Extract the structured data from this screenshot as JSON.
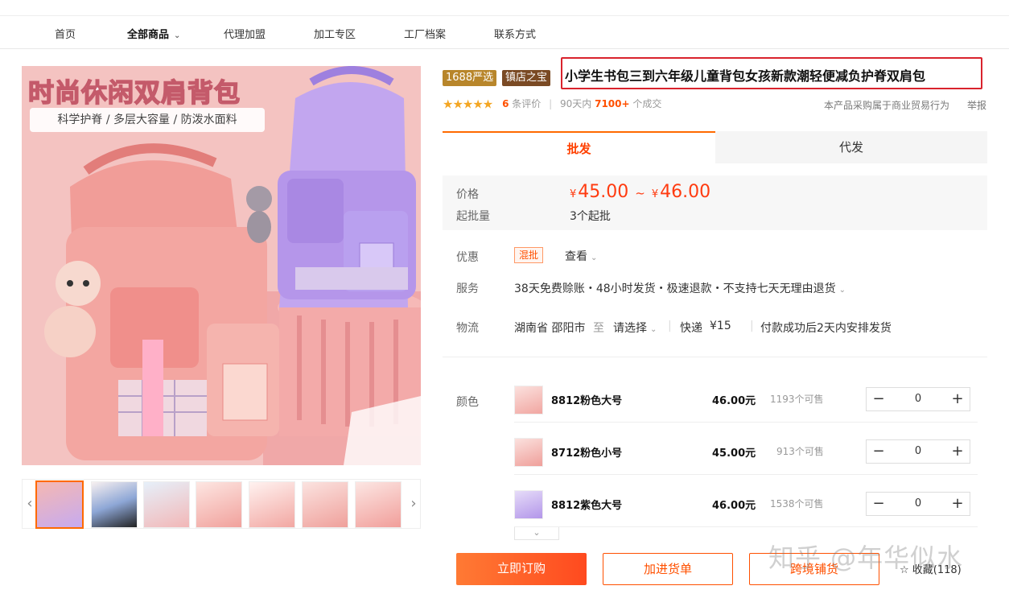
{
  "nav": {
    "items": [
      "首页",
      "全部商品",
      "代理加盟",
      "加工专区",
      "工厂档案",
      "联系方式"
    ]
  },
  "gallery": {
    "hero_title": "时尚休闲双肩背包",
    "hero_subtitle": "科学护脊 / 多层大容量 / 防泼水面料",
    "prev_arrow": "‹",
    "next_arrow": "›"
  },
  "product": {
    "badge_1688": "1688严选",
    "badge_store": "镇店之宝",
    "title": "小学生书包三到六年级儿童背包女孩新款潮轻便减负护脊双肩包",
    "stars": "★★★★★",
    "review_count": "6",
    "review_label": "条评价",
    "sep": "|",
    "days_label": "90天内",
    "deals_count": "7100+",
    "deals_label": "个成交",
    "trade_note": "本产品采购属于商业贸易行为",
    "report": "举报"
  },
  "tabs": {
    "wholesale": "批发",
    "dropship": "代发"
  },
  "pricing": {
    "price_label": "价格",
    "currency": "¥",
    "price_min": "45.00",
    "tilde": "~",
    "price_max": "46.00",
    "moq_label": "起批量",
    "moq_value": "3个起批"
  },
  "details": {
    "promo_label": "优惠",
    "promo_tag": "混批",
    "promo_link": "查看",
    "service_label": "服务",
    "service_value": "38天免费赊账・48小时发货・极速退款・不支持七天无理由退货",
    "logistics_label": "物流",
    "origin": "湖南省 邵阳市",
    "to": "至",
    "destination": "请选择",
    "express": "快递",
    "express_fee": "¥15",
    "ship_note": "付款成功后2天内安排发货"
  },
  "sku": {
    "label": "颜色",
    "stock_suffix": "个可售",
    "items": [
      {
        "name": "8812粉色大号",
        "price": "46.00元",
        "stock": "1193个可售",
        "qty": "0"
      },
      {
        "name": "8712粉色小号",
        "price": "45.00元",
        "stock": "913个可售",
        "qty": "0"
      },
      {
        "name": "8812紫色大号",
        "price": "46.00元",
        "stock": "1538个可售",
        "qty": "0"
      }
    ],
    "minus": "−",
    "plus": "+",
    "expand": "⌄"
  },
  "actions": {
    "buy_now": "立即订购",
    "add_cart": "加进货单",
    "cross_border": "跨境铺货",
    "favorite": "☆ 收藏(118)"
  },
  "watermark": "知乎 @年华似水",
  "colors": {
    "accent": "#ff5000",
    "badge_1688": "#b8862b",
    "badge_store": "#7a4a24",
    "title_border": "#d9232d"
  }
}
